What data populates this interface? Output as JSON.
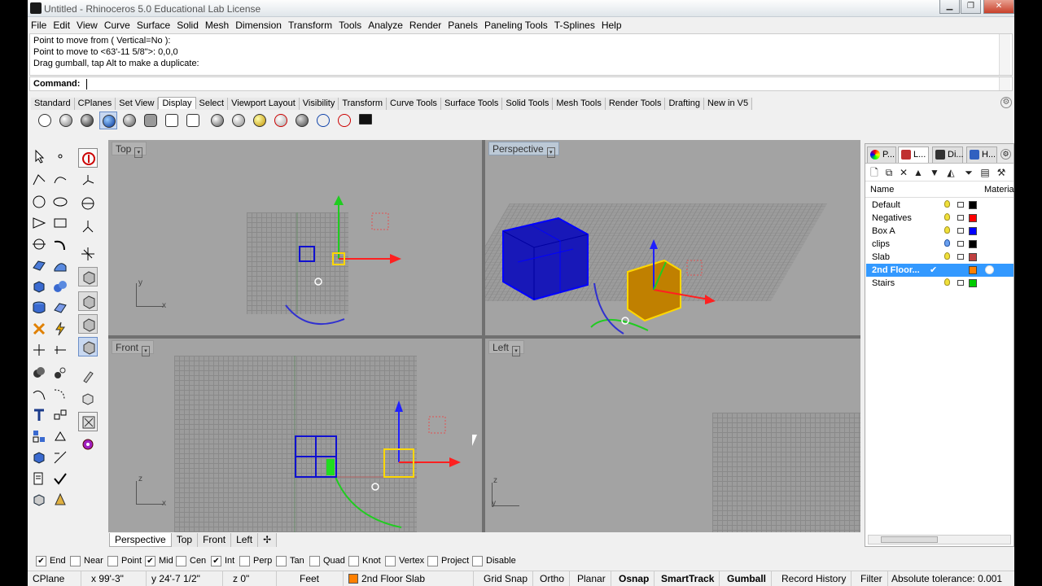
{
  "window": {
    "title": "Untitled - Rhinoceros 5.0 Educational Lab License",
    "minimize": "▁",
    "maximize": "❐",
    "close": "✕"
  },
  "menu": [
    "File",
    "Edit",
    "View",
    "Curve",
    "Surface",
    "Solid",
    "Mesh",
    "Dimension",
    "Transform",
    "Tools",
    "Analyze",
    "Render",
    "Panels",
    "Paneling Tools",
    "T-Splines",
    "Help"
  ],
  "history": [
    "Point to move from ( Vertical=No ):",
    "Point to move to <63'-11 5/8\">: 0,0,0",
    "Drag gumball, tap Alt to make a duplicate:"
  ],
  "command": {
    "label": "Command:"
  },
  "toolbar_tabs": [
    "Standard",
    "CPlanes",
    "Set View",
    "Display",
    "Select",
    "Viewport Layout",
    "Visibility",
    "Transform",
    "Curve Tools",
    "Surface Tools",
    "Solid Tools",
    "Mesh Tools",
    "Render Tools",
    "Drafting",
    "New in V5"
  ],
  "active_tab": "Display",
  "viewports": {
    "top": "Top",
    "perspective": "Perspective",
    "front": "Front",
    "left": "Left",
    "dropdown": "▾",
    "axis": {
      "x": "x",
      "y": "y",
      "z": "z"
    }
  },
  "viewport_tabs": [
    "Perspective",
    "Top",
    "Front",
    "Left",
    "✢"
  ],
  "panel": {
    "tabs": [
      "P...",
      "L...",
      "Di...",
      "H..."
    ],
    "col_name": "Name",
    "col_material": "Material",
    "layers": [
      {
        "name": "Default",
        "color": "#000000"
      },
      {
        "name": "Negatives",
        "color": "#ff0000"
      },
      {
        "name": "Box A",
        "color": "#0000ff"
      },
      {
        "name": "clips",
        "color": "#000000"
      },
      {
        "name": "Slab",
        "color": "#c04040"
      },
      {
        "name": "2nd Floor...",
        "color": "#ff8000",
        "current": "✔"
      },
      {
        "name": "Stairs",
        "color": "#00cc00"
      }
    ]
  },
  "osnaps": [
    {
      "label": "End",
      "checked": true
    },
    {
      "label": "Near",
      "checked": false
    },
    {
      "label": "Point",
      "checked": false
    },
    {
      "label": "Mid",
      "checked": true
    },
    {
      "label": "Cen",
      "checked": false
    },
    {
      "label": "Int",
      "checked": true
    },
    {
      "label": "Perp",
      "checked": false
    },
    {
      "label": "Tan",
      "checked": false
    },
    {
      "label": "Quad",
      "checked": false
    },
    {
      "label": "Knot",
      "checked": false
    },
    {
      "label": "Vertex",
      "checked": false
    },
    {
      "label": "Project",
      "checked": false
    },
    {
      "label": "Disable",
      "checked": false
    }
  ],
  "status": {
    "cplane": "CPlane",
    "x": "x 99'-3\"",
    "y": "y 24'-7 1/2\"",
    "z": "z 0\"",
    "units": "Feet",
    "layer": "2nd Floor Slab",
    "layer_color": "#ff8000",
    "grid_snap": "Grid Snap",
    "ortho": "Ortho",
    "planar": "Planar",
    "osnap": "Osnap",
    "smarttrack": "SmartTrack",
    "gumball": "Gumball",
    "record_history": "Record History",
    "filter": "Filter",
    "tolerance": "Absolute tolerance: 0.001"
  },
  "colors": {
    "selection": "#ffd700",
    "gumball_x": "#ff2020",
    "gumball_y": "#20cc20",
    "gumball_z": "#2020ff",
    "box": "#1010d0",
    "viewport_bg": "#a3a3a3"
  }
}
